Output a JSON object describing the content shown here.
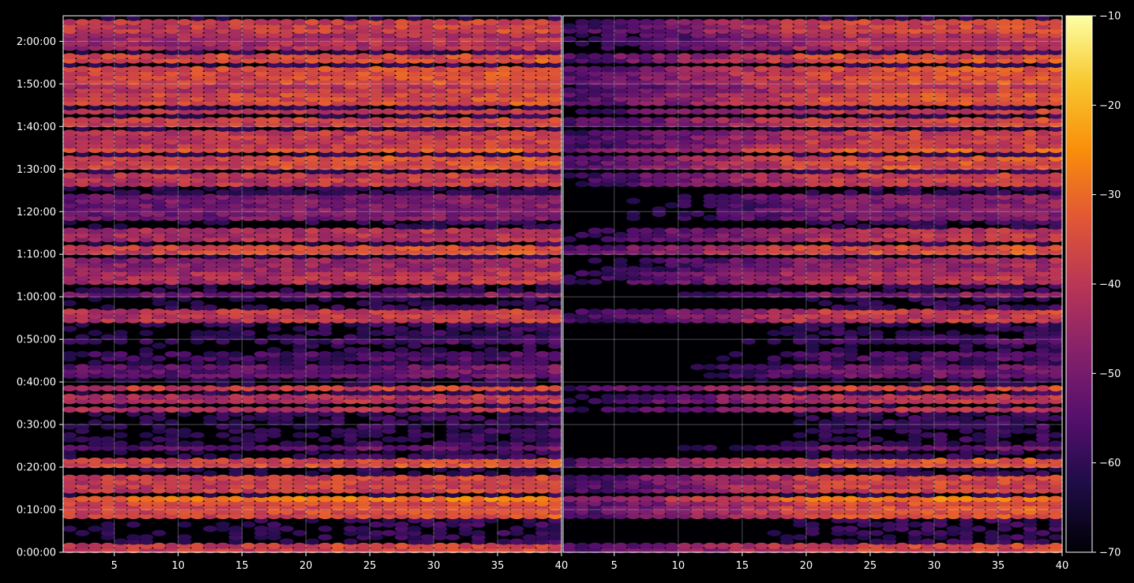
{
  "chart_data": {
    "type": "heatmap",
    "panels": [
      {
        "name": "",
        "x_ticks": [
          5,
          10,
          15,
          20,
          25,
          30,
          35,
          40
        ],
        "xlim": [
          1,
          40
        ],
        "channels": 39
      },
      {
        "name": "",
        "x_ticks": [
          5,
          10,
          15,
          20,
          25,
          30,
          35,
          40
        ],
        "xlim": [
          1,
          40
        ],
        "channels": 39
      }
    ],
    "y_ticks": [
      "0:00:00",
      "0:10:00",
      "0:20:00",
      "0:30:00",
      "0:40:00",
      "0:50:00",
      "1:00:00",
      "1:10:00",
      "1:20:00",
      "1:30:00",
      "1:40:00",
      "1:50:00",
      "2:00:00"
    ],
    "y_tick_minutes": [
      0,
      10,
      20,
      30,
      40,
      50,
      60,
      70,
      80,
      90,
      100,
      110,
      120
    ],
    "ylim_minutes": [
      0,
      126
    ],
    "time_bins": 126,
    "colorbar": {
      "ticks": [
        "−10",
        "−20",
        "−30",
        "−40",
        "−50",
        "−60",
        "−70"
      ],
      "tick_values": [
        -10,
        -20,
        -30,
        -40,
        -50,
        -60,
        -70
      ],
      "vmin": -70,
      "vmax": -10,
      "colormap": "inferno"
    },
    "grid": true,
    "background": "#000000"
  }
}
